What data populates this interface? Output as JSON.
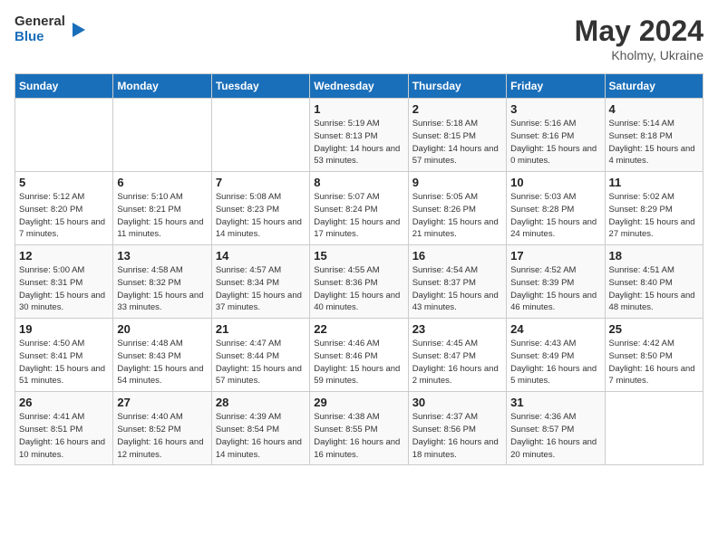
{
  "header": {
    "logo_general": "General",
    "logo_blue": "Blue",
    "title": "May 2024",
    "location": "Kholmy, Ukraine"
  },
  "weekdays": [
    "Sunday",
    "Monday",
    "Tuesday",
    "Wednesday",
    "Thursday",
    "Friday",
    "Saturday"
  ],
  "weeks": [
    [
      {
        "day": "",
        "sunrise": "",
        "sunset": "",
        "daylight": ""
      },
      {
        "day": "",
        "sunrise": "",
        "sunset": "",
        "daylight": ""
      },
      {
        "day": "",
        "sunrise": "",
        "sunset": "",
        "daylight": ""
      },
      {
        "day": "1",
        "sunrise": "Sunrise: 5:19 AM",
        "sunset": "Sunset: 8:13 PM",
        "daylight": "Daylight: 14 hours and 53 minutes."
      },
      {
        "day": "2",
        "sunrise": "Sunrise: 5:18 AM",
        "sunset": "Sunset: 8:15 PM",
        "daylight": "Daylight: 14 hours and 57 minutes."
      },
      {
        "day": "3",
        "sunrise": "Sunrise: 5:16 AM",
        "sunset": "Sunset: 8:16 PM",
        "daylight": "Daylight: 15 hours and 0 minutes."
      },
      {
        "day": "4",
        "sunrise": "Sunrise: 5:14 AM",
        "sunset": "Sunset: 8:18 PM",
        "daylight": "Daylight: 15 hours and 4 minutes."
      }
    ],
    [
      {
        "day": "5",
        "sunrise": "Sunrise: 5:12 AM",
        "sunset": "Sunset: 8:20 PM",
        "daylight": "Daylight: 15 hours and 7 minutes."
      },
      {
        "day": "6",
        "sunrise": "Sunrise: 5:10 AM",
        "sunset": "Sunset: 8:21 PM",
        "daylight": "Daylight: 15 hours and 11 minutes."
      },
      {
        "day": "7",
        "sunrise": "Sunrise: 5:08 AM",
        "sunset": "Sunset: 8:23 PM",
        "daylight": "Daylight: 15 hours and 14 minutes."
      },
      {
        "day": "8",
        "sunrise": "Sunrise: 5:07 AM",
        "sunset": "Sunset: 8:24 PM",
        "daylight": "Daylight: 15 hours and 17 minutes."
      },
      {
        "day": "9",
        "sunrise": "Sunrise: 5:05 AM",
        "sunset": "Sunset: 8:26 PM",
        "daylight": "Daylight: 15 hours and 21 minutes."
      },
      {
        "day": "10",
        "sunrise": "Sunrise: 5:03 AM",
        "sunset": "Sunset: 8:28 PM",
        "daylight": "Daylight: 15 hours and 24 minutes."
      },
      {
        "day": "11",
        "sunrise": "Sunrise: 5:02 AM",
        "sunset": "Sunset: 8:29 PM",
        "daylight": "Daylight: 15 hours and 27 minutes."
      }
    ],
    [
      {
        "day": "12",
        "sunrise": "Sunrise: 5:00 AM",
        "sunset": "Sunset: 8:31 PM",
        "daylight": "Daylight: 15 hours and 30 minutes."
      },
      {
        "day": "13",
        "sunrise": "Sunrise: 4:58 AM",
        "sunset": "Sunset: 8:32 PM",
        "daylight": "Daylight: 15 hours and 33 minutes."
      },
      {
        "day": "14",
        "sunrise": "Sunrise: 4:57 AM",
        "sunset": "Sunset: 8:34 PM",
        "daylight": "Daylight: 15 hours and 37 minutes."
      },
      {
        "day": "15",
        "sunrise": "Sunrise: 4:55 AM",
        "sunset": "Sunset: 8:36 PM",
        "daylight": "Daylight: 15 hours and 40 minutes."
      },
      {
        "day": "16",
        "sunrise": "Sunrise: 4:54 AM",
        "sunset": "Sunset: 8:37 PM",
        "daylight": "Daylight: 15 hours and 43 minutes."
      },
      {
        "day": "17",
        "sunrise": "Sunrise: 4:52 AM",
        "sunset": "Sunset: 8:39 PM",
        "daylight": "Daylight: 15 hours and 46 minutes."
      },
      {
        "day": "18",
        "sunrise": "Sunrise: 4:51 AM",
        "sunset": "Sunset: 8:40 PM",
        "daylight": "Daylight: 15 hours and 48 minutes."
      }
    ],
    [
      {
        "day": "19",
        "sunrise": "Sunrise: 4:50 AM",
        "sunset": "Sunset: 8:41 PM",
        "daylight": "Daylight: 15 hours and 51 minutes."
      },
      {
        "day": "20",
        "sunrise": "Sunrise: 4:48 AM",
        "sunset": "Sunset: 8:43 PM",
        "daylight": "Daylight: 15 hours and 54 minutes."
      },
      {
        "day": "21",
        "sunrise": "Sunrise: 4:47 AM",
        "sunset": "Sunset: 8:44 PM",
        "daylight": "Daylight: 15 hours and 57 minutes."
      },
      {
        "day": "22",
        "sunrise": "Sunrise: 4:46 AM",
        "sunset": "Sunset: 8:46 PM",
        "daylight": "Daylight: 15 hours and 59 minutes."
      },
      {
        "day": "23",
        "sunrise": "Sunrise: 4:45 AM",
        "sunset": "Sunset: 8:47 PM",
        "daylight": "Daylight: 16 hours and 2 minutes."
      },
      {
        "day": "24",
        "sunrise": "Sunrise: 4:43 AM",
        "sunset": "Sunset: 8:49 PM",
        "daylight": "Daylight: 16 hours and 5 minutes."
      },
      {
        "day": "25",
        "sunrise": "Sunrise: 4:42 AM",
        "sunset": "Sunset: 8:50 PM",
        "daylight": "Daylight: 16 hours and 7 minutes."
      }
    ],
    [
      {
        "day": "26",
        "sunrise": "Sunrise: 4:41 AM",
        "sunset": "Sunset: 8:51 PM",
        "daylight": "Daylight: 16 hours and 10 minutes."
      },
      {
        "day": "27",
        "sunrise": "Sunrise: 4:40 AM",
        "sunset": "Sunset: 8:52 PM",
        "daylight": "Daylight: 16 hours and 12 minutes."
      },
      {
        "day": "28",
        "sunrise": "Sunrise: 4:39 AM",
        "sunset": "Sunset: 8:54 PM",
        "daylight": "Daylight: 16 hours and 14 minutes."
      },
      {
        "day": "29",
        "sunrise": "Sunrise: 4:38 AM",
        "sunset": "Sunset: 8:55 PM",
        "daylight": "Daylight: 16 hours and 16 minutes."
      },
      {
        "day": "30",
        "sunrise": "Sunrise: 4:37 AM",
        "sunset": "Sunset: 8:56 PM",
        "daylight": "Daylight: 16 hours and 18 minutes."
      },
      {
        "day": "31",
        "sunrise": "Sunrise: 4:36 AM",
        "sunset": "Sunset: 8:57 PM",
        "daylight": "Daylight: 16 hours and 20 minutes."
      },
      {
        "day": "",
        "sunrise": "",
        "sunset": "",
        "daylight": ""
      }
    ]
  ]
}
